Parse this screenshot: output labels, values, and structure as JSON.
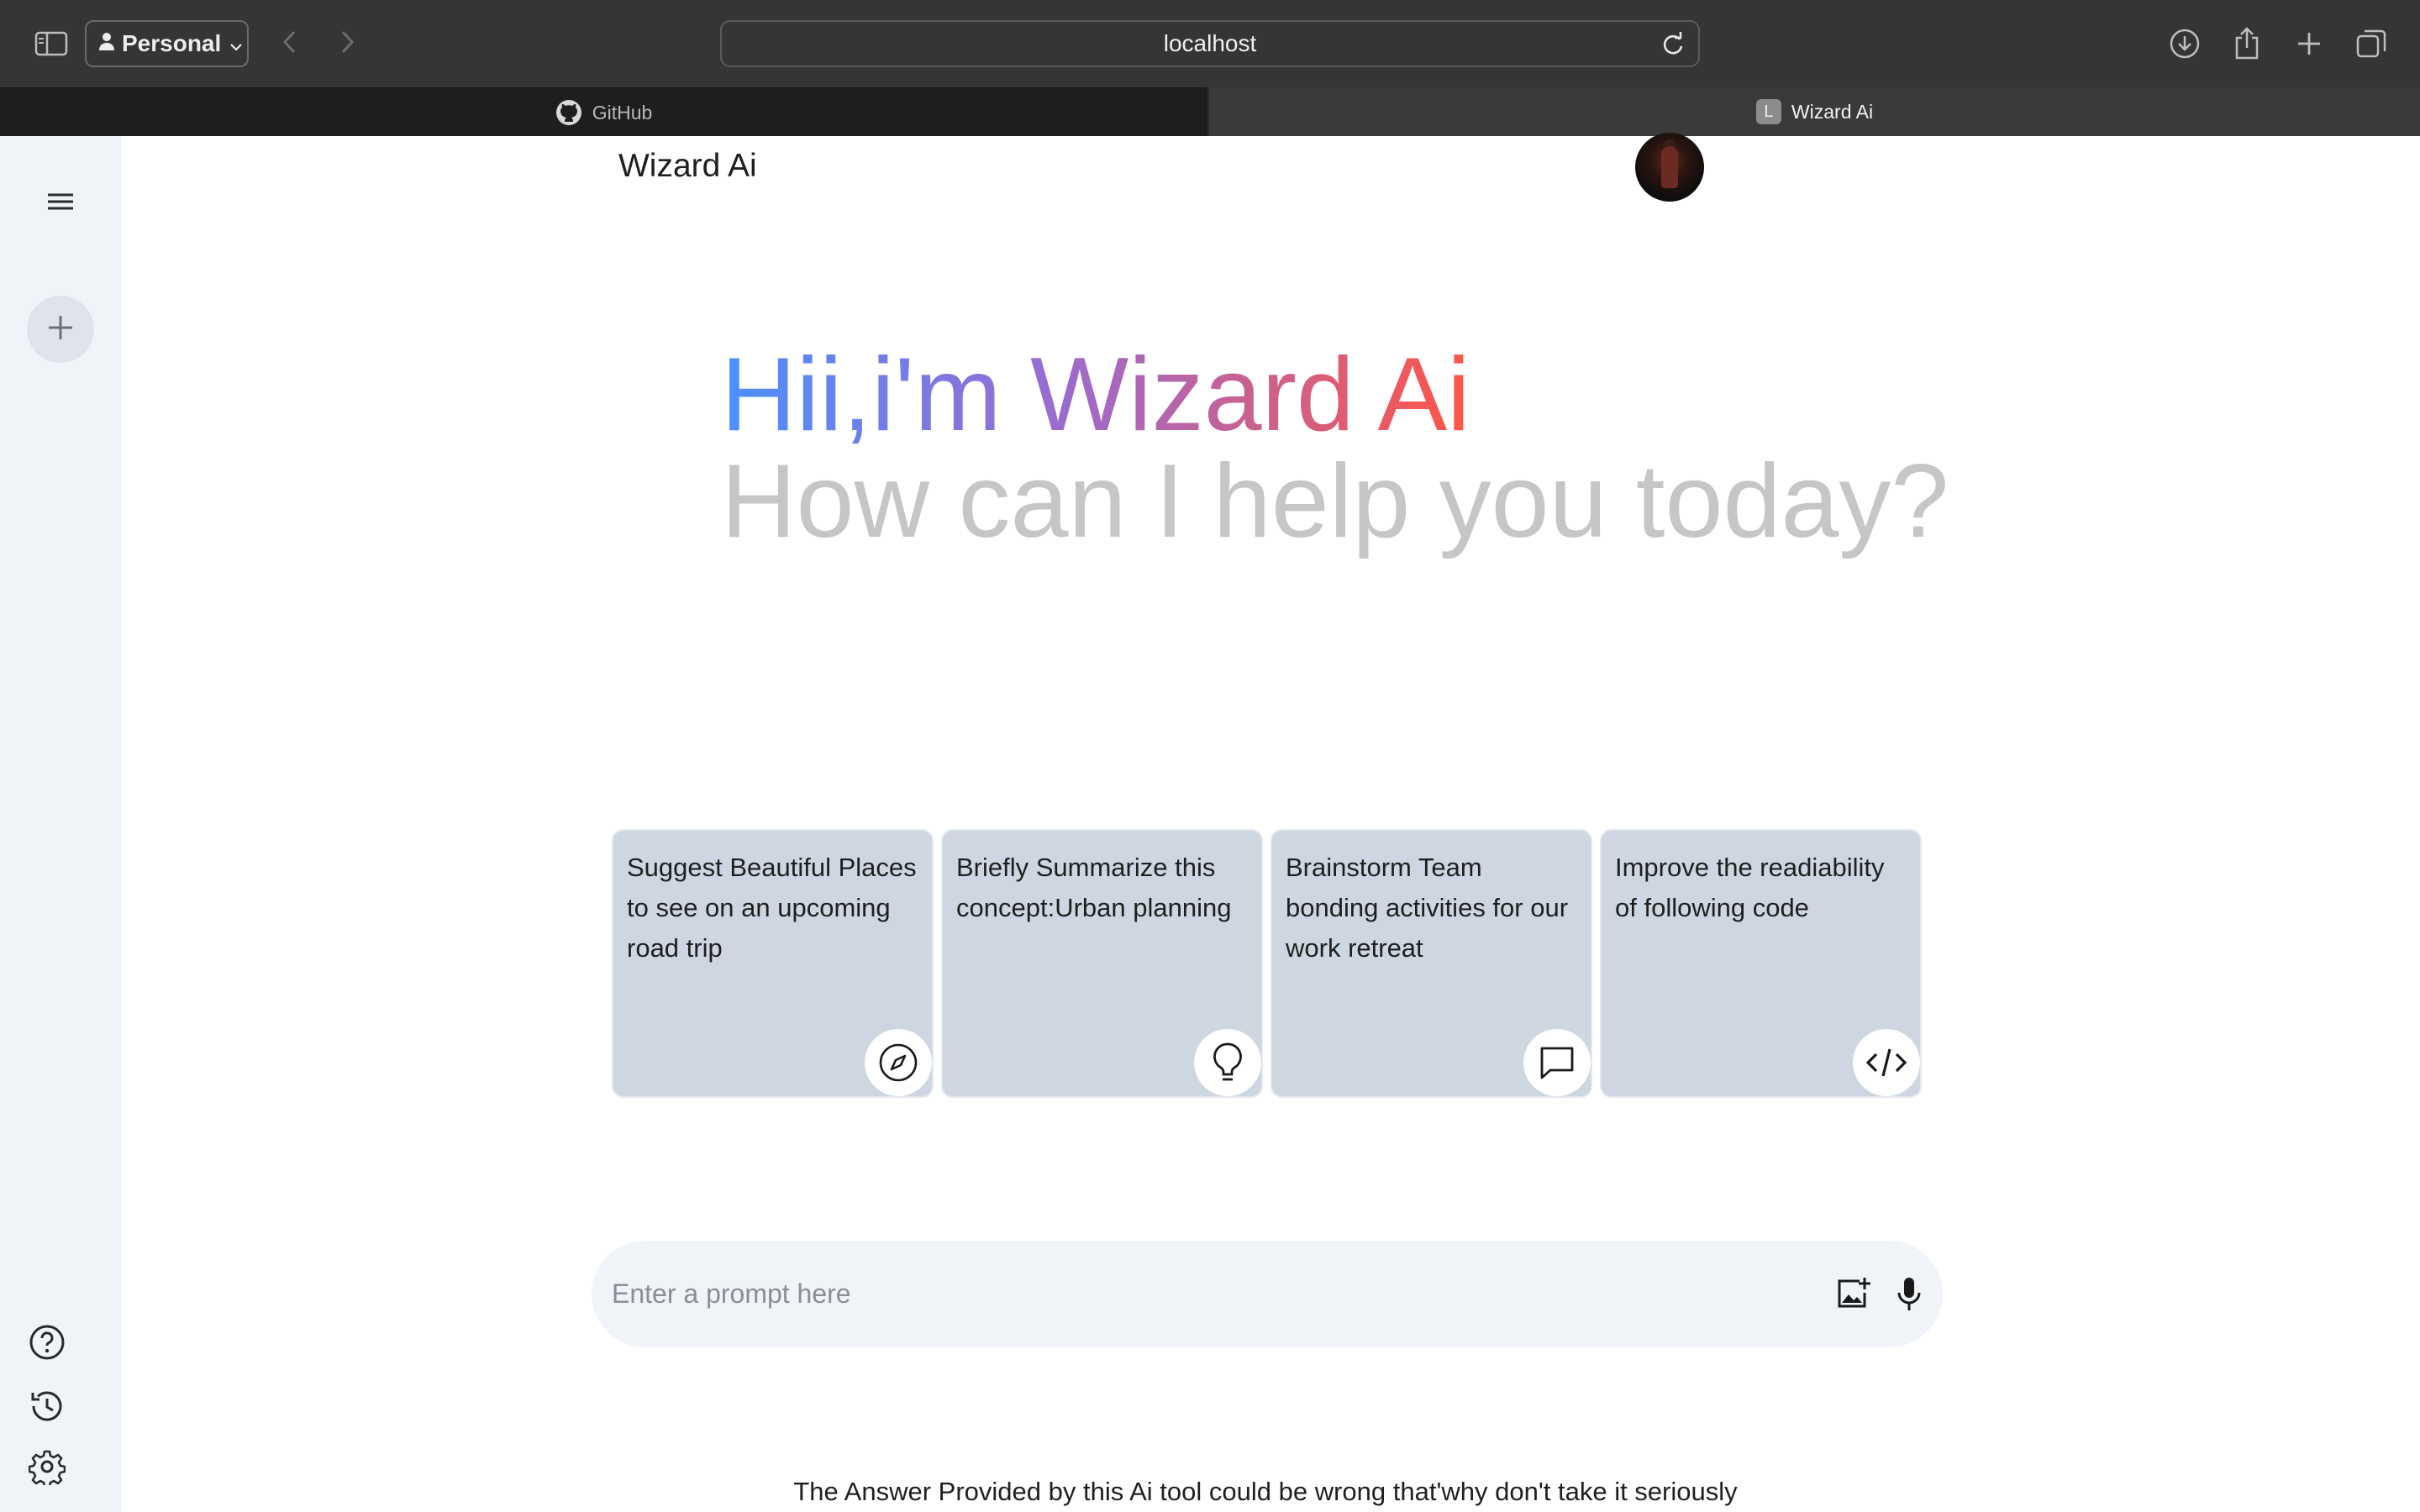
{
  "browser": {
    "profile_label": "Personal",
    "address": "localhost",
    "tabs": [
      {
        "label": "GitHub",
        "icon": "github-icon"
      },
      {
        "label": "Wizard Ai",
        "icon_letter": "L"
      }
    ]
  },
  "header": {
    "title": "Wizard Ai"
  },
  "greeting": {
    "line1": "Hii,i'm Wizard Ai",
    "line2": "How can I help you today?",
    "gradient_colors": [
      "#4b90ff",
      "#9a6bd0",
      "#ff5546"
    ]
  },
  "cards": [
    {
      "text": "Suggest Beautiful Places to see on an upcoming road trip",
      "icon": "compass-icon"
    },
    {
      "text": "Briefly Summarize this concept:Urban planning",
      "icon": "bulb-icon"
    },
    {
      "text": "Brainstorm Team bonding activities for our work retreat",
      "icon": "message-icon"
    },
    {
      "text": "Improve the readiability of following code",
      "icon": "code-icon"
    }
  ],
  "prompt": {
    "placeholder": "Enter a prompt here",
    "value": ""
  },
  "footer": {
    "disclaimer": "The Answer Provided by this Ai tool could be wrong that'why don't take it seriously"
  },
  "colors": {
    "sidebar_bg": "#f0f4f9",
    "card_bg": "#cdd6e1",
    "muted_text": "#c4c7c5",
    "chrome_bg": "#353535"
  }
}
